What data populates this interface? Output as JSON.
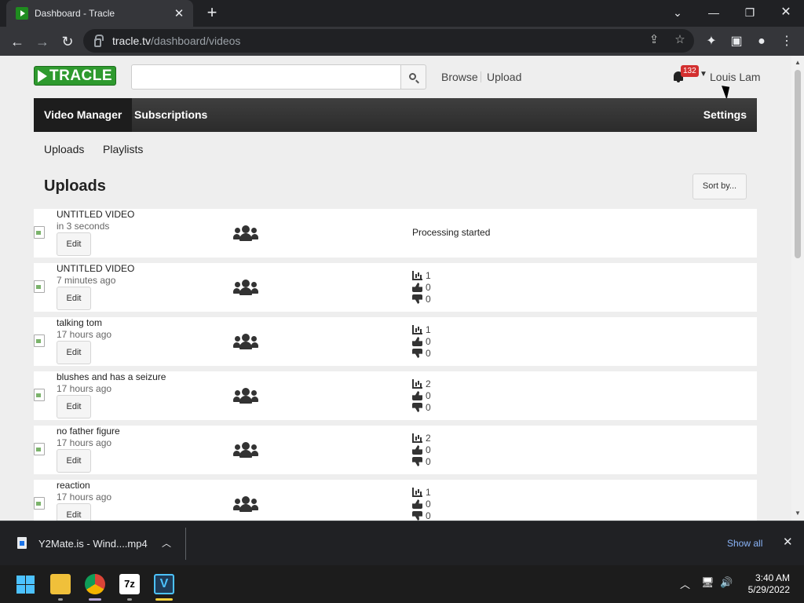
{
  "browser": {
    "tab_title": "Dashboard - Tracle",
    "url_domain": "tracle.tv",
    "url_path": "/dashboard/videos"
  },
  "site": {
    "logo_text": "TRACLE",
    "search_placeholder": "",
    "links": {
      "browse": "Browse",
      "upload": "Upload"
    },
    "notification_count": "132",
    "user_name": "Louis Lam"
  },
  "nav": {
    "tabs": [
      "Video Manager",
      "Subscriptions"
    ],
    "settings": "Settings",
    "sub_tabs": [
      "Uploads",
      "Playlists"
    ]
  },
  "main": {
    "heading": "Uploads",
    "sort_label": "Sort by...",
    "edit_label": "Edit",
    "videos": [
      {
        "title": "UNTITLED VIDEO",
        "time": "in 3 seconds",
        "status": "Processing started"
      },
      {
        "title": "UNTITLED VIDEO",
        "time": "7 minutes ago",
        "views": "1",
        "likes": "0",
        "dislikes": "0"
      },
      {
        "title": "talking tom",
        "time": "17 hours ago",
        "views": "1",
        "likes": "0",
        "dislikes": "0"
      },
      {
        "title": "blushes and has a seizure",
        "time": "17 hours ago",
        "views": "2",
        "likes": "0",
        "dislikes": "0"
      },
      {
        "title": "no father figure",
        "time": "17 hours ago",
        "views": "2",
        "likes": "0",
        "dislikes": "0"
      },
      {
        "title": "reaction",
        "time": "17 hours ago",
        "views": "1",
        "likes": "0",
        "dislikes": "0"
      }
    ]
  },
  "downloads": {
    "file_name": "Y2Mate.is - Wind....mp4",
    "show_all": "Show all"
  },
  "taskbar": {
    "time": "3:40 AM",
    "date": "5/29/2022"
  },
  "colors": {
    "brand_green": "#2e9a2e",
    "badge_red": "#d32f2f",
    "nav_dark": "#2b2b2b",
    "link_blue": "#8ab4f8"
  }
}
